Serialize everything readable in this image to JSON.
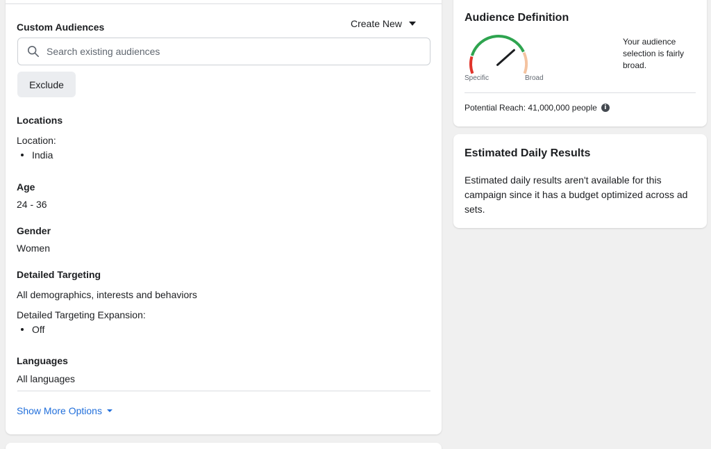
{
  "custom_audiences": {
    "title": "Custom Audiences",
    "create_new_label": "Create New",
    "search_placeholder": "Search existing audiences",
    "exclude_label": "Exclude"
  },
  "locations": {
    "title": "Locations",
    "subtitle": "Location:",
    "items": [
      "India"
    ]
  },
  "age": {
    "title": "Age",
    "value": "24 - 36"
  },
  "gender": {
    "title": "Gender",
    "value": "Women"
  },
  "detailed_targeting": {
    "title": "Detailed Targeting",
    "value": "All demographics, interests and behaviors",
    "expansion_label": "Detailed Targeting Expansion:",
    "expansion_items": [
      "Off"
    ]
  },
  "languages": {
    "title": "Languages",
    "value": "All languages"
  },
  "show_more_label": "Show More Options",
  "audience_definition": {
    "title": "Audience Definition",
    "specific_label": "Specific",
    "broad_label": "Broad",
    "selection_text": "Your audience selection is fairly broad.",
    "potential_reach": "Potential Reach: 41,000,000 people",
    "gauge_level": 0.72,
    "colors": {
      "low": "#e0342b",
      "mid": "#2ea44f",
      "high": "#f4c3a0",
      "needle": "#1c1e21"
    }
  },
  "estimated_daily_results": {
    "title": "Estimated Daily Results",
    "text": "Estimated daily results aren't available for this campaign since it has a budget optimized across ad sets."
  },
  "icons": {
    "search": "search-icon",
    "info": "info-icon",
    "caret": "caret-down-icon"
  },
  "accent_color": "#216fdb"
}
